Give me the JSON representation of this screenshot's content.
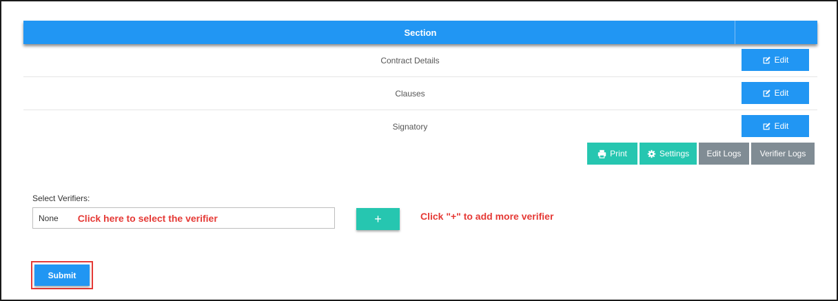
{
  "table": {
    "header": "Section",
    "rows": [
      {
        "label": "Contract Details",
        "button": "Edit"
      },
      {
        "label": "Clauses",
        "button": "Edit"
      },
      {
        "label": "Signatory",
        "button": "Edit"
      }
    ]
  },
  "actions": {
    "print": "Print",
    "settings": "Settings",
    "edit_logs": "Edit Logs",
    "verifier_logs": "Verifier Logs"
  },
  "verifiers": {
    "label": "Select Verifiers:",
    "value": "None",
    "select_hint": "Click here to select the verifier",
    "add_button": "+",
    "add_hint": "Click \"+\" to add more verifier"
  },
  "submit": {
    "label": "Submit"
  },
  "colors": {
    "primary": "#2196f3",
    "teal": "#26c6b0",
    "gray": "#808c94",
    "annotation": "#e53935"
  }
}
